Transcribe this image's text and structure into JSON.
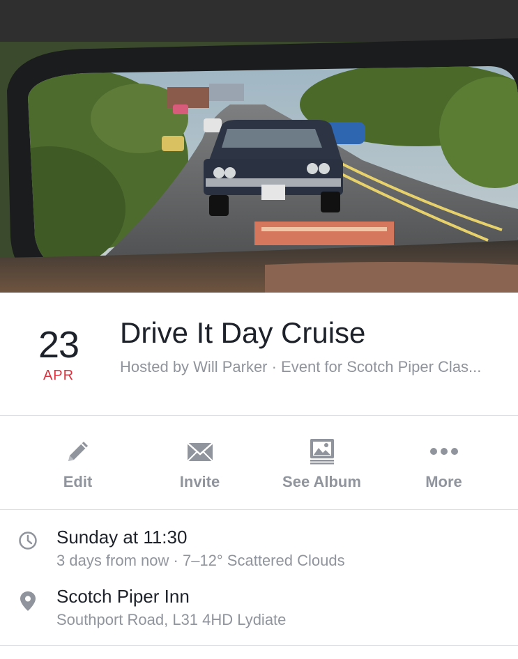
{
  "cover": {
    "image": "classic car seen in rear-view mirror"
  },
  "event": {
    "day": "23",
    "month": "APR",
    "title": "Drive It Day Cruise",
    "subtitle": "Hosted by Will Parker · Event for Scotch Piper Clas..."
  },
  "actions": [
    {
      "label": "Edit",
      "icon": "pencil-icon"
    },
    {
      "label": "Invite",
      "icon": "envelope-icon"
    },
    {
      "label": "See Album",
      "icon": "photo-album-icon"
    },
    {
      "label": "More",
      "icon": "more-dots-icon"
    }
  ],
  "details": {
    "time": {
      "icon": "clock-icon",
      "main": "Sunday at 11:30",
      "sub": "3 days from now · 7–12° Scattered Clouds"
    },
    "location": {
      "icon": "location-pin-icon",
      "main": "Scotch Piper Inn",
      "sub": "Southport Road, L31 4HD Lydiate"
    }
  },
  "colors": {
    "accent_date": "#d9333f",
    "secondary_text": "#90949c",
    "primary_text": "#1d2129",
    "divider": "#dddfe2"
  }
}
